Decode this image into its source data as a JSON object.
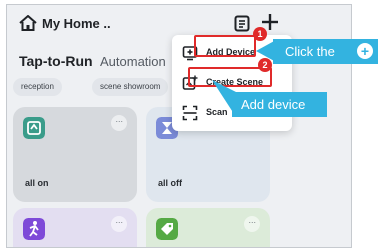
{
  "header": {
    "title": "My Home .."
  },
  "tabs": {
    "active": "Tap-to-Run",
    "other": "Automation"
  },
  "chips": [
    "reception",
    "scene showroom"
  ],
  "cards": [
    {
      "label": "all on",
      "color": "#d6d9dd",
      "icon_color": "#3a9c8a"
    },
    {
      "label": "all off",
      "color": "#dfe6ee",
      "icon_color": "#7b8bd8"
    },
    {
      "label": "",
      "color": "#e3def1",
      "icon_color": "#7e4ad8"
    },
    {
      "label": "",
      "color": "#dcebd9",
      "icon_color": "#55a944"
    }
  ],
  "menu": {
    "items": [
      {
        "label": "Add Device",
        "icon": "add-device-icon"
      },
      {
        "label": "Create Scene",
        "icon": "create-scene-icon"
      },
      {
        "label": "Scan",
        "icon": "scan-icon"
      }
    ]
  },
  "markers": [
    "1",
    "2"
  ],
  "callouts": {
    "click_plus": "Click the",
    "add_device": "Add device"
  },
  "colors": {
    "callout": "#33b3e0",
    "highlight": "#e02a2a",
    "background": "#eef0f3"
  }
}
